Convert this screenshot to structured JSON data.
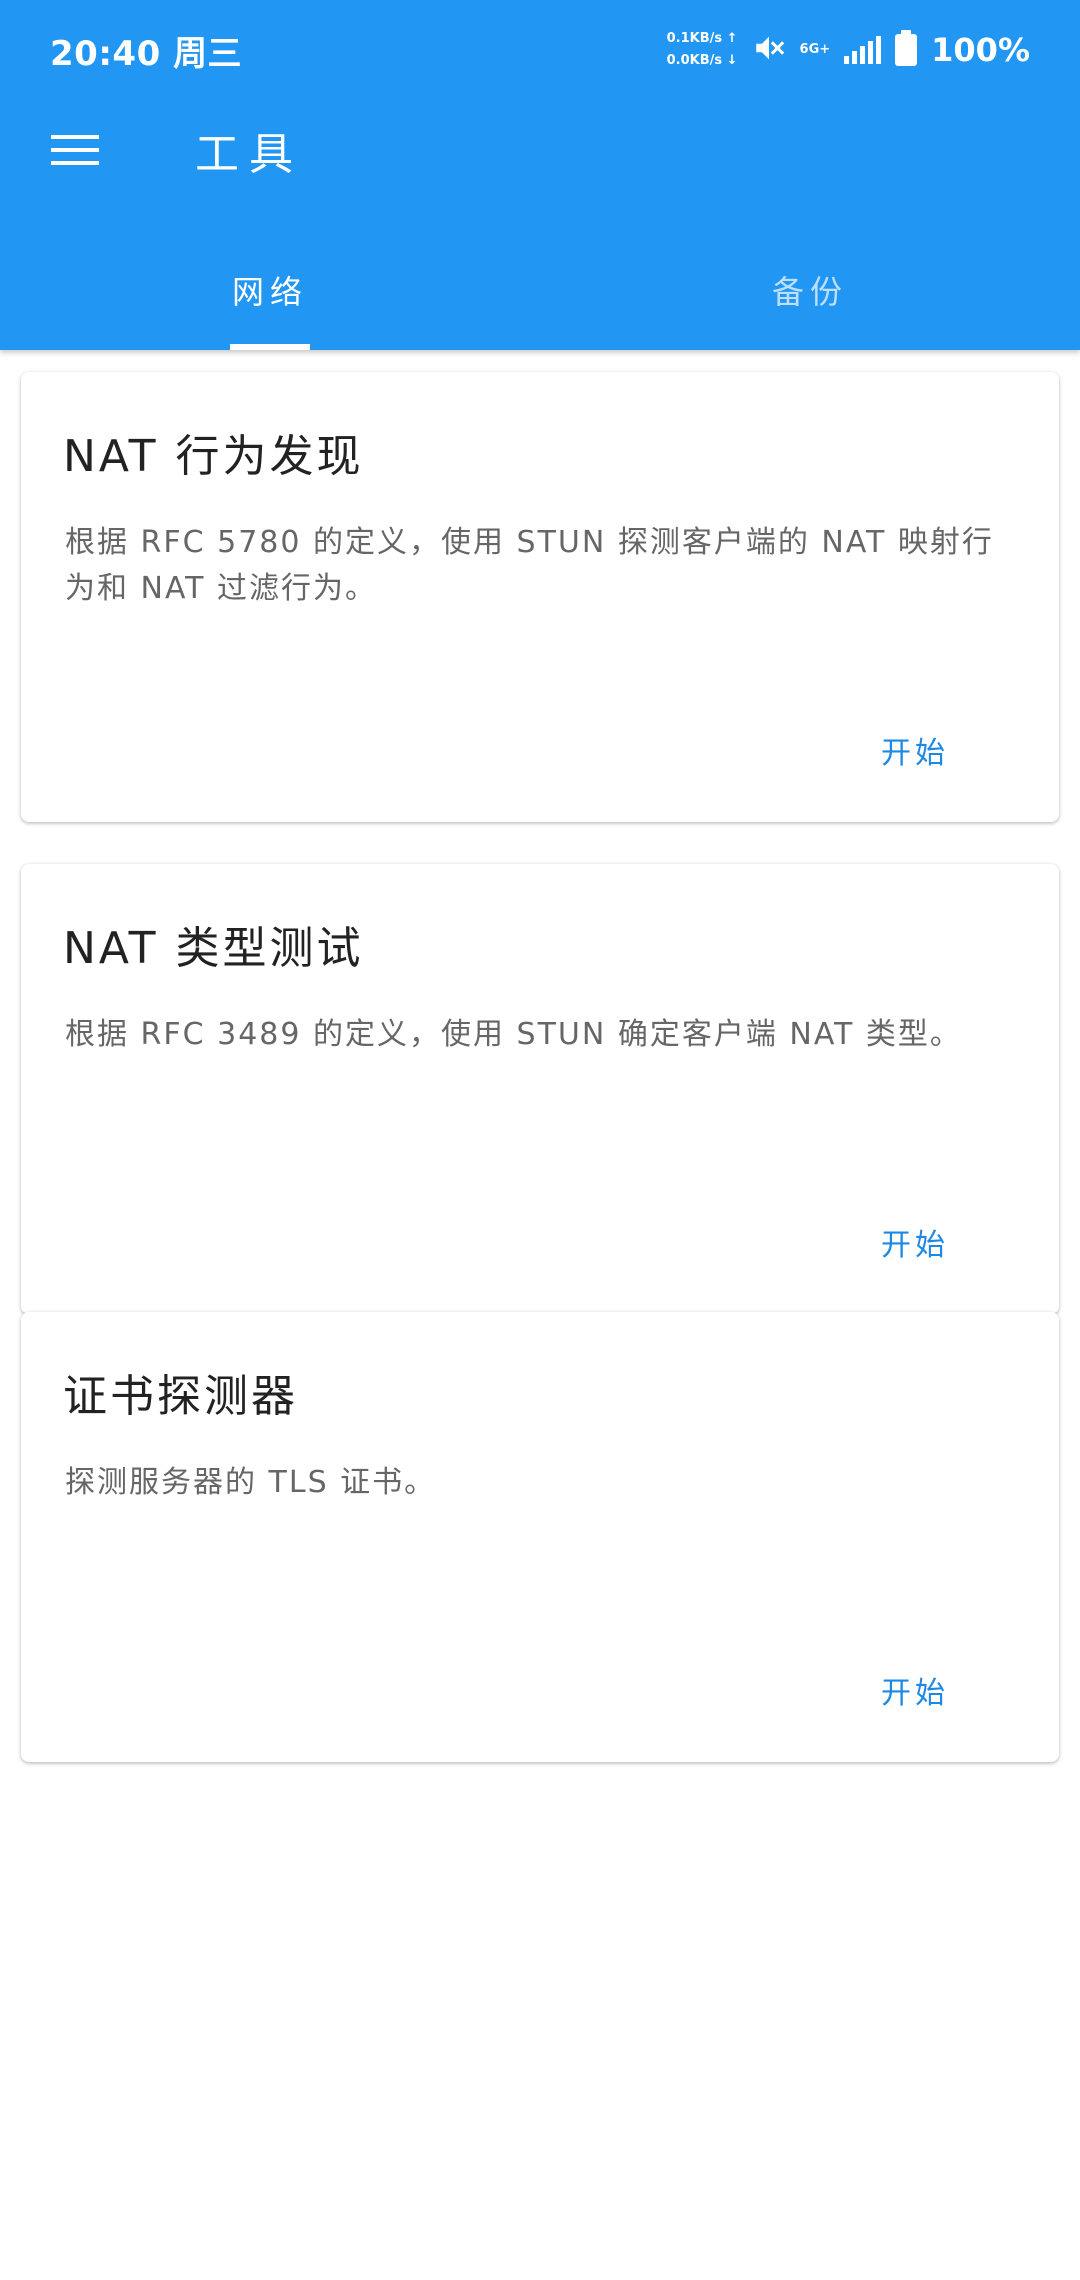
{
  "status_bar": {
    "time": "20:40 周三",
    "upload_speed": "0.1KB/s ↑",
    "download_speed": "0.0KB/s ↓",
    "network_type": "6G+",
    "battery": "100%"
  },
  "toolbar": {
    "title": "工具"
  },
  "tabs": [
    {
      "label": "网络",
      "selected": true
    },
    {
      "label": "备份",
      "selected": false
    }
  ],
  "cards": [
    {
      "title": "NAT 行为发现",
      "description": "根据 RFC 5780 的定义，使用 STUN 探测客户端的 NAT 映射行为和 NAT 过滤行为。",
      "action": "开始"
    },
    {
      "title": "NAT 类型测试",
      "description": "根据 RFC 3489 的定义，使用 STUN 确定客户端 NAT 类型。",
      "action": "开始"
    },
    {
      "title": "证书探测器",
      "description": "探测服务器的 TLS 证书。",
      "action": "开始"
    }
  ],
  "colors": {
    "primary": "#2196F3",
    "accent": "#1E88E5"
  }
}
